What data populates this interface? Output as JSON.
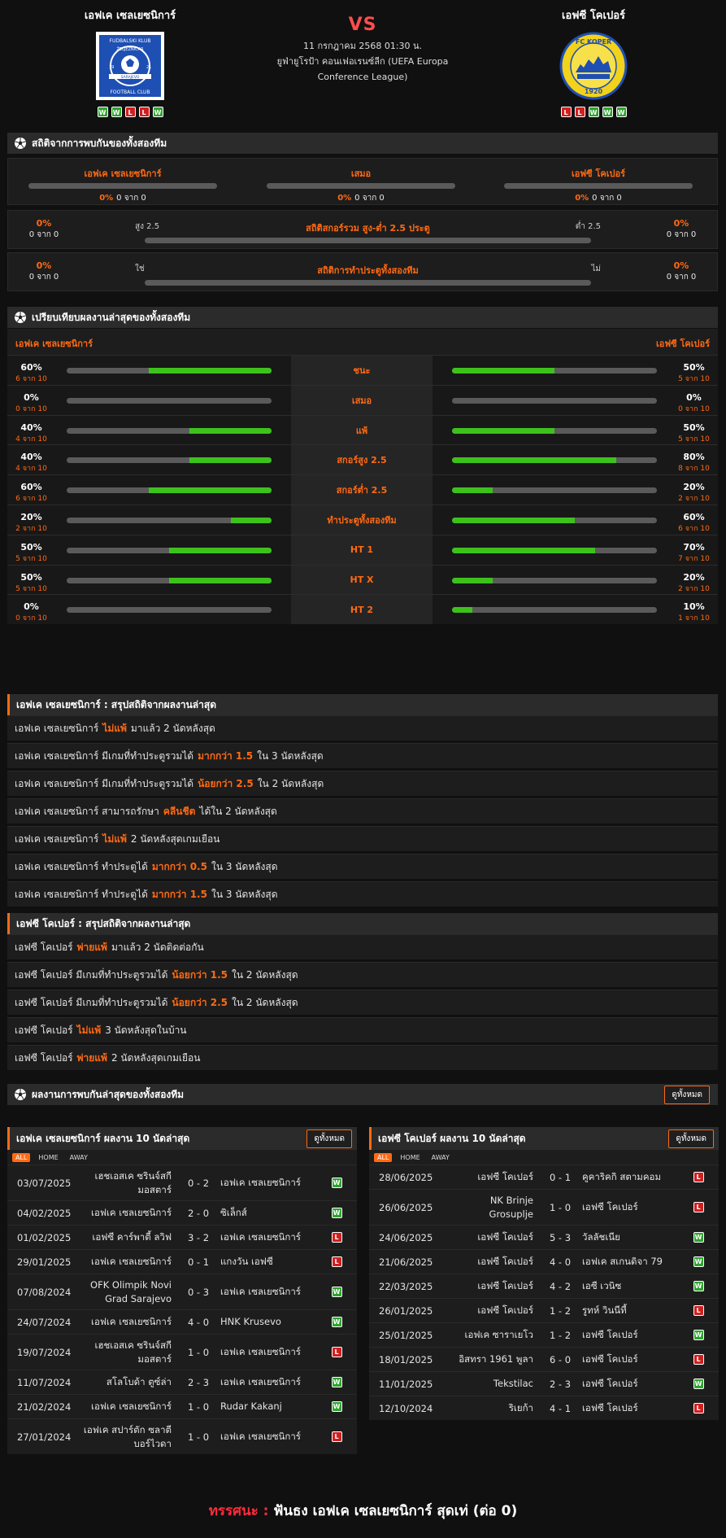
{
  "match": {
    "home_name": "เอฟเค เซลเยซนิการ์",
    "away_name": "เอฟซี โคเปอร์",
    "vs": "VS",
    "datetime": "11 กรกฎาคม 2568 01:30 น.",
    "competition": "ยูฟ่ายูโรป้า คอนเฟอเรนซ์ลีก (UEFA Europa Conference League)",
    "home_form": [
      "W",
      "W",
      "L",
      "L",
      "W"
    ],
    "away_form": [
      "L",
      "L",
      "W",
      "W",
      "W"
    ],
    "home_logo_text": [
      "FUDBALSKI KLUB",
      "ŽELJEZNIČAR",
      "SARAJEVO",
      "FOOTBALL CLUB",
      "19",
      "21"
    ],
    "away_logo_text": [
      "FC KOPER",
      "1920"
    ]
  },
  "h2h": {
    "title": "สถิติจากการพบกันของทั้งสองทีม",
    "home_label": "เอฟเค เซลเยซนิการ์",
    "draw_label": "เสมอ",
    "away_label": "เอฟซี โคเปอร์",
    "home_pct": "0%",
    "home_of": "0 จาก 0",
    "draw_pct": "0%",
    "draw_of": "0 จาก 0",
    "away_pct": "0%",
    "away_of": "0 จาก 0",
    "ou": {
      "title": "สถิติสกอร์รวม สูง-ต่ำ 2.5 ประตู",
      "left_tag": "สูง 2.5",
      "right_tag": "ต่ำ 2.5",
      "left_pct": "0%",
      "left_of": "0 จาก 0",
      "right_pct": "0%",
      "right_of": "0 จาก 0"
    },
    "btts": {
      "title": "สถิติการทำประตูทั้งสองทีม",
      "left_tag": "ใช่",
      "right_tag": "ไม่",
      "left_pct": "0%",
      "left_of": "0 จาก 0",
      "right_pct": "0%",
      "right_of": "0 จาก 0"
    }
  },
  "compare": {
    "title": "เปรียบเทียบผลงานล่าสุดของทั้งสองทีม",
    "home_label": "เอฟเค เซลเยซนิการ์",
    "away_label": "เอฟซี โคเปอร์",
    "rows": [
      {
        "label": "ชนะ",
        "home_pct": "60%",
        "home_of": "6 จาก 10",
        "home_val": 0.6,
        "away_pct": "50%",
        "away_of": "5 จาก 10",
        "away_val": 0.5
      },
      {
        "label": "เสมอ",
        "home_pct": "0%",
        "home_of": "0 จาก 10",
        "home_val": 0.0,
        "away_pct": "0%",
        "away_of": "0 จาก 10",
        "away_val": 0.0
      },
      {
        "label": "แพ้",
        "home_pct": "40%",
        "home_of": "4 จาก 10",
        "home_val": 0.4,
        "away_pct": "50%",
        "away_of": "5 จาก 10",
        "away_val": 0.5
      },
      {
        "label": "สกอร์สูง 2.5",
        "home_pct": "40%",
        "home_of": "4 จาก 10",
        "home_val": 0.4,
        "away_pct": "80%",
        "away_of": "8 จาก 10",
        "away_val": 0.8
      },
      {
        "label": "สกอร์ต่ำ 2.5",
        "home_pct": "60%",
        "home_of": "6 จาก 10",
        "home_val": 0.6,
        "away_pct": "20%",
        "away_of": "2 จาก 10",
        "away_val": 0.2
      },
      {
        "label": "ทำประตูทั้งสองทีม",
        "home_pct": "20%",
        "home_of": "2 จาก 10",
        "home_val": 0.2,
        "away_pct": "60%",
        "away_of": "6 จาก 10",
        "away_val": 0.6
      },
      {
        "label": "HT 1",
        "home_pct": "50%",
        "home_of": "5 จาก 10",
        "home_val": 0.5,
        "away_pct": "70%",
        "away_of": "7 จาก 10",
        "away_val": 0.7
      },
      {
        "label": "HT X",
        "home_pct": "50%",
        "home_of": "5 จาก 10",
        "home_val": 0.5,
        "away_pct": "20%",
        "away_of": "2 จาก 10",
        "away_val": 0.2
      },
      {
        "label": "HT 2",
        "home_pct": "0%",
        "home_of": "0 จาก 10",
        "home_val": 0.0,
        "away_pct": "10%",
        "away_of": "1 จาก 10",
        "away_val": 0.1
      }
    ]
  },
  "home_summary": {
    "title": "เอฟเค เซลเยซนิการ์ : สรุปสถิติจากผลงานล่าสุด",
    "rows": [
      [
        "เอฟเค เซลเยซนิการ์",
        "ไม่แพ้",
        "มาแล้ว 2 นัดหลังสุด"
      ],
      [
        "เอฟเค เซลเยซนิการ์ มีเกมที่ทำประตูรวมได้",
        "มากกว่า 1.5",
        "ใน 3 นัดหลังสุด"
      ],
      [
        "เอฟเค เซลเยซนิการ์ มีเกมที่ทำประตูรวมได้",
        "น้อยกว่า 2.5",
        "ใน 2 นัดหลังสุด"
      ],
      [
        "เอฟเค เซลเยซนิการ์ สามารถรักษา",
        "คลีนชีต",
        "ได้ใน 2 นัดหลังสุด"
      ],
      [
        "เอฟเค เซลเยซนิการ์",
        "ไม่แพ้",
        "2 นัดหลังสุดเกมเยือน"
      ],
      [
        "เอฟเค เซลเยซนิการ์ ทำประตูได้",
        "มากกว่า 0.5",
        "ใน 3 นัดหลังสุด"
      ],
      [
        "เอฟเค เซลเยซนิการ์ ทำประตูได้",
        "มากกว่า 1.5",
        "ใน 3 นัดหลังสุด"
      ]
    ]
  },
  "away_summary": {
    "title": "เอฟซี โคเปอร์ : สรุปสถิติจากผลงานล่าสุด",
    "rows": [
      [
        "เอฟซี โคเปอร์",
        "พ่ายแพ้",
        "มาแล้ว 2 นัดติดต่อกัน"
      ],
      [
        "เอฟซี โคเปอร์ มีเกมที่ทำประตูรวมได้",
        "น้อยกว่า 1.5",
        "ใน 2 นัดหลังสุด"
      ],
      [
        "เอฟซี โคเปอร์ มีเกมที่ทำประตูรวมได้",
        "น้อยกว่า 2.5",
        "ใน 2 นัดหลังสุด"
      ],
      [
        "เอฟซี โคเปอร์",
        "ไม่แพ้",
        "3 นัดหลังสุดในบ้าน"
      ],
      [
        "เอฟซี โคเปอร์",
        "พ่ายแพ้",
        "2 นัดหลังสุดเกมเยือน"
      ]
    ]
  },
  "recent": {
    "title": "ผลงานการพบกันล่าสุดของทั้งสองทีม",
    "view_all": "ดูทั้งหมด",
    "tabs": [
      "ALL",
      "HOME",
      "AWAY"
    ],
    "home_title": "เอฟเค เซลเยซนิการ์ ผลงาน 10 นัดล่าสุด",
    "away_title": "เอฟซี โคเปอร์ ผลงาน 10 นัดล่าสุด",
    "home_rows": [
      {
        "date": "03/07/2025",
        "home": "เฮชเอสเค ซรินจ์สกี มอสตาร์",
        "score": "0 - 2",
        "away": "เอฟเค เซลเยซนิการ์",
        "res": "W",
        "tall": true
      },
      {
        "date": "04/02/2025",
        "home": "เอฟเค เซลเยซนิการ์",
        "score": "2 - 0",
        "away": "ซิเล็กส์",
        "res": "W",
        "tall": false
      },
      {
        "date": "01/02/2025",
        "home": "เอฟซี คาร์พาตี้ ลวิฟ",
        "score": "3 - 2",
        "away": "เอฟเค เซลเยซนิการ์",
        "res": "L",
        "tall": false
      },
      {
        "date": "29/01/2025",
        "home": "เอฟเค เซลเยซนิการ์",
        "score": "0 - 1",
        "away": "แกงวัน เอฟซี",
        "res": "L",
        "tall": false
      },
      {
        "date": "07/08/2024",
        "home": "OFK Olimpik Novi Grad Sarajevo",
        "score": "0 - 3",
        "away": "เอฟเค เซลเยซนิการ์",
        "res": "W",
        "tall": true
      },
      {
        "date": "24/07/2024",
        "home": "เอฟเค เซลเยซนิการ์",
        "score": "4 - 0",
        "away": "HNK Krusevo",
        "res": "W",
        "tall": false
      },
      {
        "date": "19/07/2024",
        "home": "เฮชเอสเค ซรินจ์สกี มอสตาร์",
        "score": "1 - 0",
        "away": "เอฟเค เซลเยซนิการ์",
        "res": "L",
        "tall": true
      },
      {
        "date": "11/07/2024",
        "home": "สโลโบด้า ตูซ์ล่า",
        "score": "2 - 3",
        "away": "เอฟเค เซลเยซนิการ์",
        "res": "W",
        "tall": false
      },
      {
        "date": "21/02/2024",
        "home": "เอฟเค เซลเยซนิการ์",
        "score": "1 - 0",
        "away": "Rudar Kakanj",
        "res": "W",
        "tall": false
      },
      {
        "date": "27/01/2024",
        "home": "เอฟเค สปาร์ตัก ซลาตีบอร์ไวดา",
        "score": "1 - 0",
        "away": "เอฟเค เซลเยซนิการ์",
        "res": "L",
        "tall": true
      }
    ],
    "away_rows": [
      {
        "date": "28/06/2025",
        "home": "เอฟซี โคเปอร์",
        "score": "0 - 1",
        "away": "คูคาริคกิ สตามคอม",
        "res": "L",
        "tall": false
      },
      {
        "date": "26/06/2025",
        "home": "NK Brinje Grosuplje",
        "score": "1 - 0",
        "away": "เอฟซี โคเปอร์",
        "res": "L",
        "tall": true
      },
      {
        "date": "24/06/2025",
        "home": "เอฟซี โคเปอร์",
        "score": "5 - 3",
        "away": "วัลลัชเนีย",
        "res": "W",
        "tall": false
      },
      {
        "date": "21/06/2025",
        "home": "เอฟซี โคเปอร์",
        "score": "4 - 0",
        "away": "เอฟเค สเกนดิจา 79",
        "res": "W",
        "tall": false
      },
      {
        "date": "22/03/2025",
        "home": "เอฟซี โคเปอร์",
        "score": "4 - 2",
        "away": "เอซี เวนิซ",
        "res": "W",
        "tall": false
      },
      {
        "date": "26/01/2025",
        "home": "เอฟซี โคเปอร์",
        "score": "1 - 2",
        "away": "รูทห์ วินนีที้",
        "res": "L",
        "tall": false
      },
      {
        "date": "25/01/2025",
        "home": "เอฟเค ซาราเยโว",
        "score": "1 - 2",
        "away": "เอฟซี โคเปอร์",
        "res": "W",
        "tall": false
      },
      {
        "date": "18/01/2025",
        "home": "อิสทรา 1961 พูลา",
        "score": "6 - 0",
        "away": "เอฟซี โคเปอร์",
        "res": "L",
        "tall": false
      },
      {
        "date": "11/01/2025",
        "home": "Tekstilac",
        "score": "2 - 3",
        "away": "เอฟซี โคเปอร์",
        "res": "W",
        "tall": false
      },
      {
        "date": "12/10/2024",
        "home": "ริเยก้า",
        "score": "4 - 1",
        "away": "เอฟซี โคเปอร์",
        "res": "L",
        "tall": false
      }
    ]
  },
  "verdict": {
    "label": "ทรรศนะ :",
    "text": "ฟันธง เอฟเค เซลเยซนิการ์ สุดเท่ (ต่อ 0)"
  },
  "colors": {
    "accent": "#ff6a13",
    "win": "#2ea42e",
    "loss": "#d11f1f",
    "bar_fill": "#3dc21b",
    "bar_bg": "#5a5a5a"
  }
}
